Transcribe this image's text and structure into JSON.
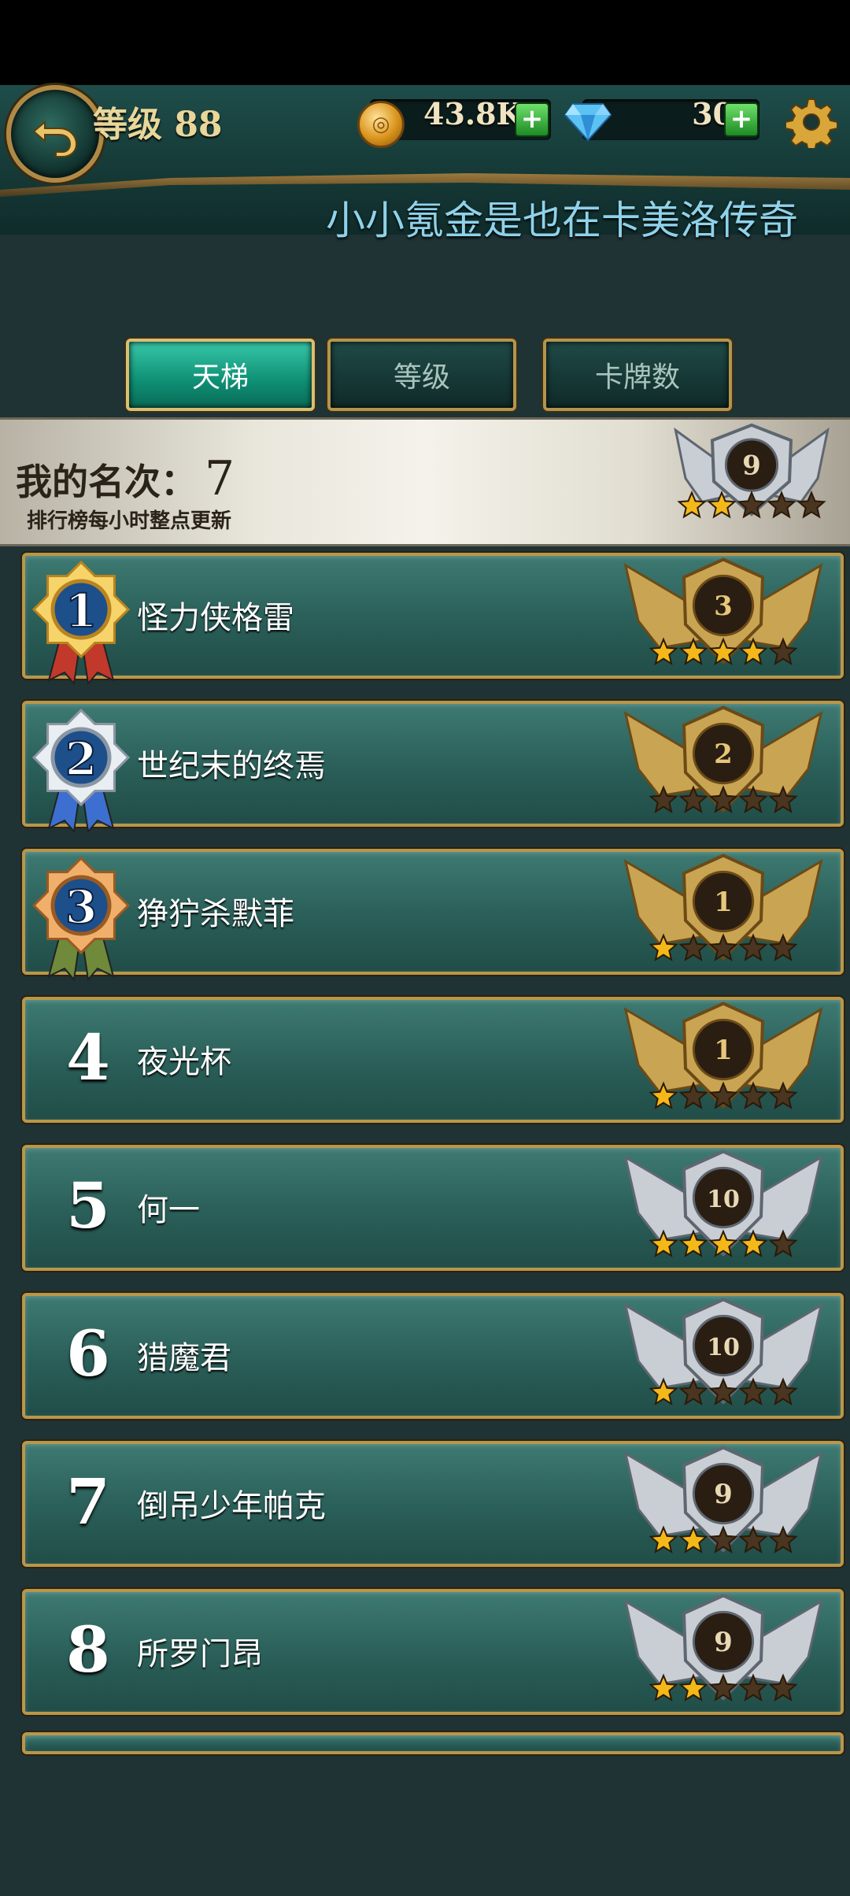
{
  "header": {
    "level_label": "等级 88",
    "coins": "43.8K",
    "gems": "30",
    "marquee": "小小氪金是也在卡美洛传奇"
  },
  "tabs": [
    {
      "label": "天梯",
      "active": true
    },
    {
      "label": "等级",
      "active": false
    },
    {
      "label": "卡牌数",
      "active": false
    }
  ],
  "my_rank": {
    "label": "我的名次：",
    "value": "7",
    "note": "排行榜每小时整点更新",
    "tier": "9",
    "stars": 2
  },
  "colors": {
    "gold_tier": "#c9a452",
    "silver_tier": "#c9ced4",
    "star_filled": "#f4b818",
    "star_empty": "#4a3520"
  },
  "rankings": [
    {
      "rank": "1",
      "name": "怪力侠格雷",
      "tier": "3",
      "stars": 4,
      "tier_type": "gold",
      "medal": "gold"
    },
    {
      "rank": "2",
      "name": "世纪末的终焉",
      "tier": "2",
      "stars": 0,
      "tier_type": "gold",
      "medal": "silver"
    },
    {
      "rank": "3",
      "name": "狰狞杀默菲",
      "tier": "1",
      "stars": 1,
      "tier_type": "gold",
      "medal": "bronze"
    },
    {
      "rank": "4",
      "name": "夜光杯",
      "tier": "1",
      "stars": 1,
      "tier_type": "gold",
      "medal": null
    },
    {
      "rank": "5",
      "name": "何一",
      "tier": "10",
      "stars": 4,
      "tier_type": "silver",
      "medal": null
    },
    {
      "rank": "6",
      "name": "猎魔君",
      "tier": "10",
      "stars": 1,
      "tier_type": "silver",
      "medal": null
    },
    {
      "rank": "7",
      "name": "倒吊少年帕克",
      "tier": "9",
      "stars": 2,
      "tier_type": "silver",
      "medal": null
    },
    {
      "rank": "8",
      "name": "所罗门昂",
      "tier": "9",
      "stars": 2,
      "tier_type": "silver",
      "medal": null
    }
  ]
}
